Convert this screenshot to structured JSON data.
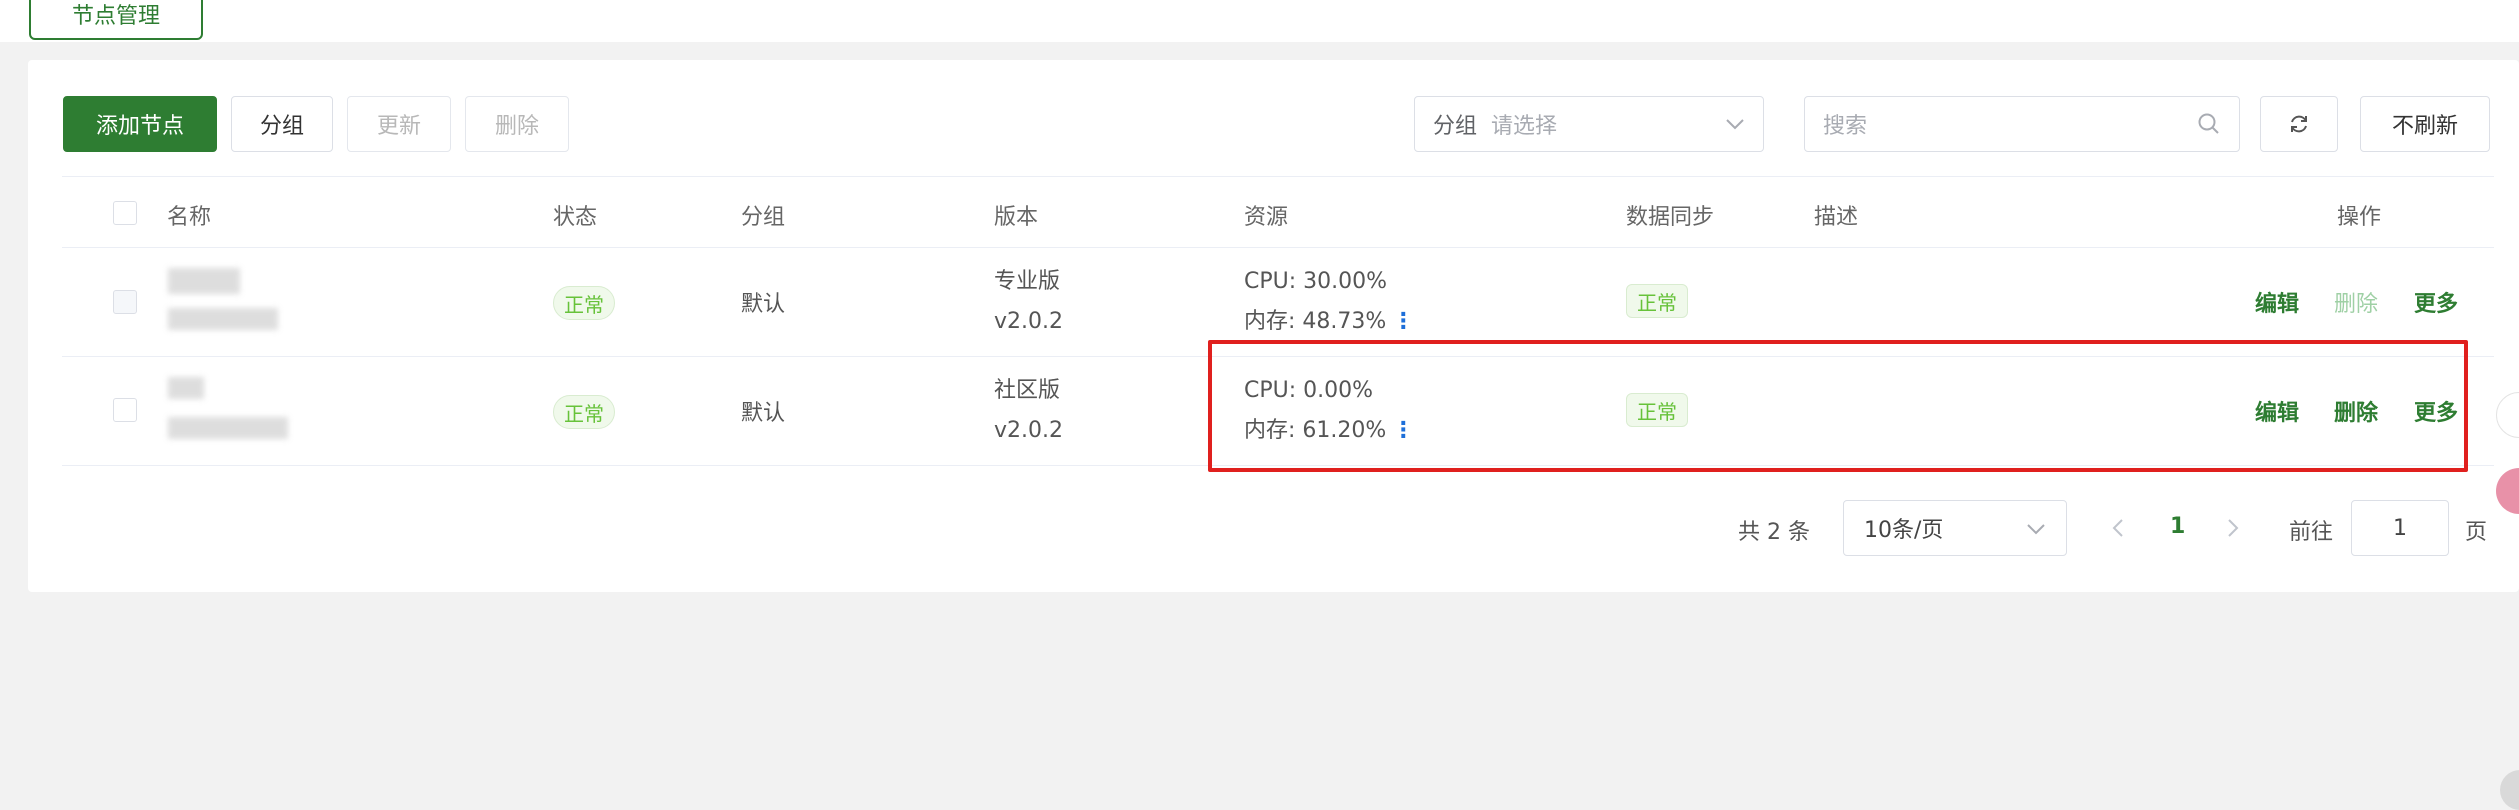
{
  "tabs": {
    "active_label": "节点管理"
  },
  "toolbar": {
    "add_label": "添加节点",
    "group_label": "分组",
    "update_label": "更新",
    "delete_label": "删除",
    "group_filter_prefix": "分组",
    "group_filter_placeholder": "请选择",
    "search_placeholder": "搜索",
    "no_refresh_label": "不刷新"
  },
  "table": {
    "headers": {
      "name": "名称",
      "status": "状态",
      "group": "分组",
      "version": "版本",
      "resource": "资源",
      "sync": "数据同步",
      "desc": "描述",
      "ops": "操作"
    },
    "rows": [
      {
        "status": "正常",
        "group": "默认",
        "edition": "专业版",
        "version": "v2.0.2",
        "cpu": "CPU: 30.00%",
        "mem": "内存: 48.73%",
        "sync": "正常",
        "edit": "编辑",
        "delete": "删除",
        "more": "更多",
        "delete_disabled": true
      },
      {
        "status": "正常",
        "group": "默认",
        "edition": "社区版",
        "version": "v2.0.2",
        "cpu": "CPU: 0.00%",
        "mem": "内存: 61.20%",
        "sync": "正常",
        "edit": "编辑",
        "delete": "删除",
        "more": "更多",
        "delete_disabled": false
      }
    ]
  },
  "pagination": {
    "total": "共 2 条",
    "page_size": "10条/页",
    "current_page": "1",
    "goto_label": "前往",
    "goto_value": "1",
    "page_suffix": "页"
  },
  "colors": {
    "primary": "#2e7d32",
    "success_tag": "#67c23a",
    "highlight": "#e0201e"
  }
}
